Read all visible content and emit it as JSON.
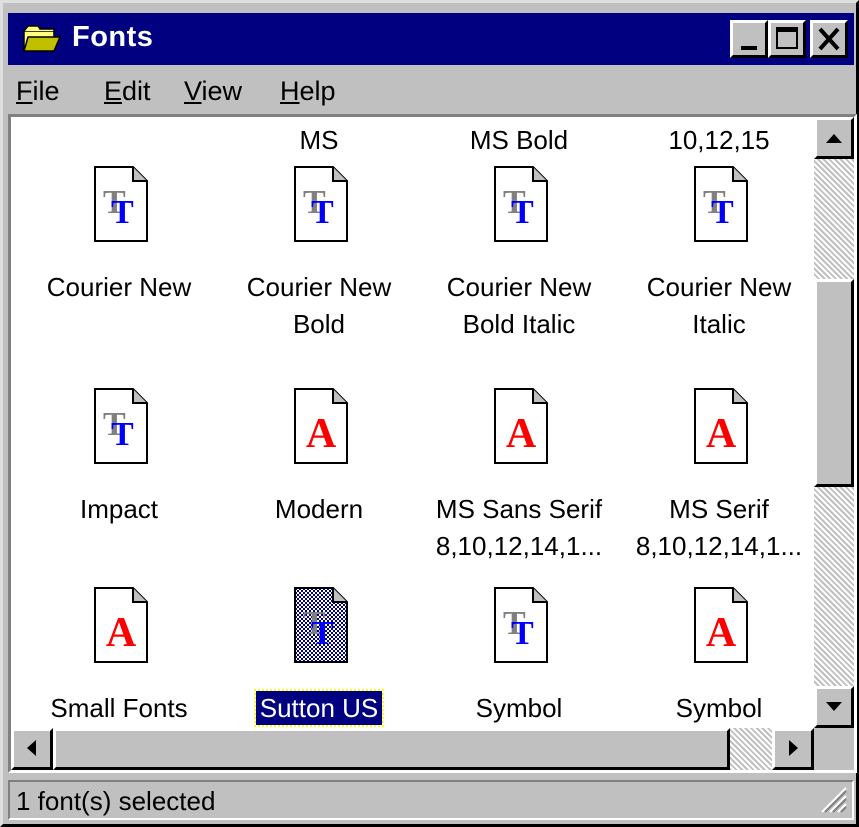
{
  "window": {
    "title": "Fonts",
    "icon": "folder-icon"
  },
  "menubar": {
    "items": [
      "File",
      "Edit",
      "View",
      "Help"
    ]
  },
  "content": {
    "partial_labels": [
      "MS",
      "MS Bold",
      "10,12,15"
    ],
    "items": [
      {
        "line1": "Courier New",
        "line2": "",
        "icon": "truetype-font-icon",
        "selected": false
      },
      {
        "line1": "Courier New",
        "line2": "Bold",
        "icon": "truetype-font-icon",
        "selected": false
      },
      {
        "line1": "Courier New",
        "line2": "Bold Italic",
        "icon": "truetype-font-icon",
        "selected": false
      },
      {
        "line1": "Courier New",
        "line2": "Italic",
        "icon": "truetype-font-icon",
        "selected": false
      },
      {
        "line1": "Impact",
        "line2": "",
        "icon": "truetype-font-icon",
        "selected": false
      },
      {
        "line1": "Modern",
        "line2": "",
        "icon": "raster-font-icon",
        "selected": false
      },
      {
        "line1": "MS Sans Serif",
        "line2": "8,10,12,14,1...",
        "icon": "raster-font-icon",
        "selected": false
      },
      {
        "line1": "MS Serif",
        "line2": "8,10,12,14,1...",
        "icon": "raster-font-icon",
        "selected": false
      },
      {
        "line1": "Small Fonts",
        "line2": "",
        "icon": "raster-font-icon",
        "selected": false
      },
      {
        "line1": "Sutton US",
        "line2": "",
        "icon": "truetype-font-icon",
        "selected": true
      },
      {
        "line1": "Symbol",
        "line2": "",
        "icon": "truetype-font-icon",
        "selected": false
      },
      {
        "line1": "Symbol",
        "line2": "",
        "icon": "raster-font-icon",
        "selected": false
      }
    ]
  },
  "statusbar": {
    "text": "1 font(s) selected"
  },
  "colors": {
    "titlebar": "#000080",
    "face": "#c0c0c0",
    "truetype_glyph": "#0000ff",
    "raster_glyph": "#ff0000",
    "selection": "#000080"
  }
}
